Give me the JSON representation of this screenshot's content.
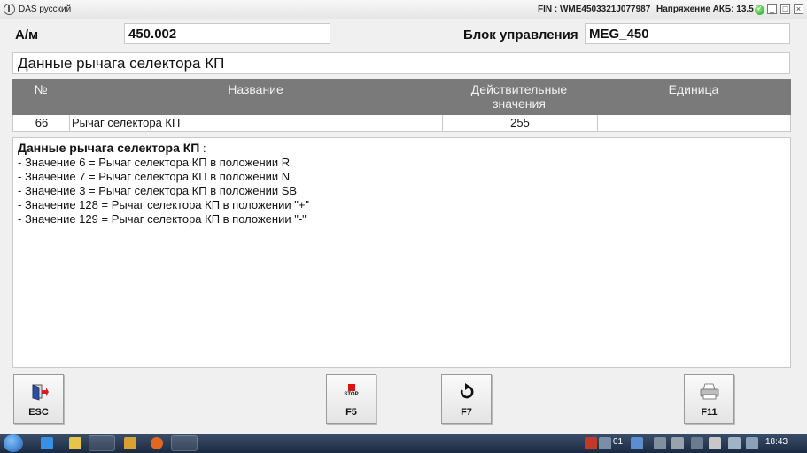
{
  "window": {
    "title": "DAS русский",
    "fin": "FIN : WME4503321J077987",
    "voltage": "Напряжение АКБ: 13.5 V",
    "controls": [
      "_",
      "□",
      "×"
    ]
  },
  "header": {
    "am_label": "А/м",
    "am_value": "450.002",
    "unit_label": "Блок управления",
    "unit_value": "MEG_450"
  },
  "section_title": "Данные рычага селектора КП",
  "table": {
    "columns": {
      "no": "№",
      "name": "Название",
      "actual_line1": "Действительные",
      "actual_line2": "значения",
      "unit": "Единица"
    },
    "rows": [
      {
        "no": "66",
        "name": "Рычаг селектора КП",
        "value": "255",
        "unit": ""
      }
    ]
  },
  "info": {
    "title": "Данные рычага селектора КП",
    "title_suffix": " :",
    "lines": [
      "- Значение 6 = Рычаг селектора КП в положении R",
      "- Значение 7 = Рычаг селектора КП в положении N",
      "- Значение 3 = Рычаг селектора КП в положении SB",
      "- Значение 128 = Рычаг селектора КП в положении \"+\"",
      "- Значение 129 = Рычаг селектора КП в положении \"-\""
    ]
  },
  "buttons": {
    "esc": "ESC",
    "f5": "F5",
    "f5_icon_text": "STOP",
    "f7": "F7",
    "f11": "F11"
  },
  "taskbar": {
    "clock": "18:43",
    "lang": "01"
  },
  "colors": {
    "table_header": "#7a7a7a",
    "stop_red": "#e01010",
    "esc_blue": "#2a4fa0"
  }
}
